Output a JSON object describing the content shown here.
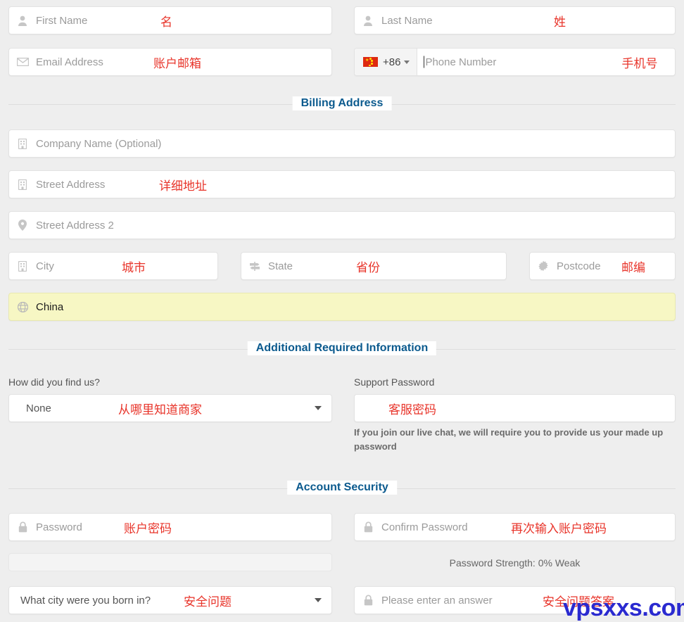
{
  "form": {
    "first_name": {
      "placeholder": "First Name",
      "annotation": "名",
      "icon": "user-icon"
    },
    "last_name": {
      "placeholder": "Last Name",
      "annotation": "姓",
      "icon": "user-icon"
    },
    "email": {
      "placeholder": "Email Address",
      "annotation": "账户邮箱",
      "icon": "envelope-icon"
    },
    "phone": {
      "placeholder": "Phone Number",
      "annotation": "手机号",
      "dial_code": "+86",
      "flag": "china-flag-icon"
    }
  },
  "sections": {
    "billing": "Billing Address",
    "additional": "Additional Required Information",
    "security": "Account Security"
  },
  "billing": {
    "company": {
      "placeholder": "Company Name (Optional)",
      "annotation": "",
      "icon": "building-icon"
    },
    "street1": {
      "placeholder": "Street Address",
      "annotation": "详细地址",
      "icon": "building-icon"
    },
    "street2": {
      "placeholder": "Street Address 2",
      "annotation": "",
      "icon": "map-pin-icon"
    },
    "city": {
      "placeholder": "City",
      "annotation": "城市",
      "icon": "building-icon"
    },
    "state": {
      "placeholder": "State",
      "annotation": "省份",
      "icon": "signpost-icon"
    },
    "postcode": {
      "placeholder": "Postcode",
      "annotation": "邮编",
      "icon": "gear-icon"
    },
    "country": {
      "value": "China",
      "annotation": "",
      "icon": "globe-icon"
    }
  },
  "additional": {
    "find_us_label": "How did you find us?",
    "find_us_value": "None",
    "find_us_annotation": "从哪里知道商家",
    "support_password_label": "Support Password",
    "support_password_annotation": "客服密码",
    "support_password_help": "If you join our live chat, we will require you to provide us your made up password"
  },
  "security": {
    "password": {
      "placeholder": "Password",
      "annotation": "账户密码",
      "icon": "lock-icon"
    },
    "confirm_password": {
      "placeholder": "Confirm Password",
      "annotation": "再次输入账户密码",
      "icon": "lock-icon"
    },
    "strength_text": "Password Strength: 0% Weak",
    "question_value": "What city were you born in?",
    "question_annotation": "安全问题",
    "answer_placeholder": "Please enter an answer",
    "answer_annotation": "安全问题答案",
    "answer_icon": "lock-icon"
  },
  "watermark": "vpsxxs.com",
  "colors": {
    "section_title": "#0b5a8e",
    "annotation": "#e8342a",
    "autofill_bg": "#f7f7c4",
    "watermark": "#2a2ad0"
  }
}
